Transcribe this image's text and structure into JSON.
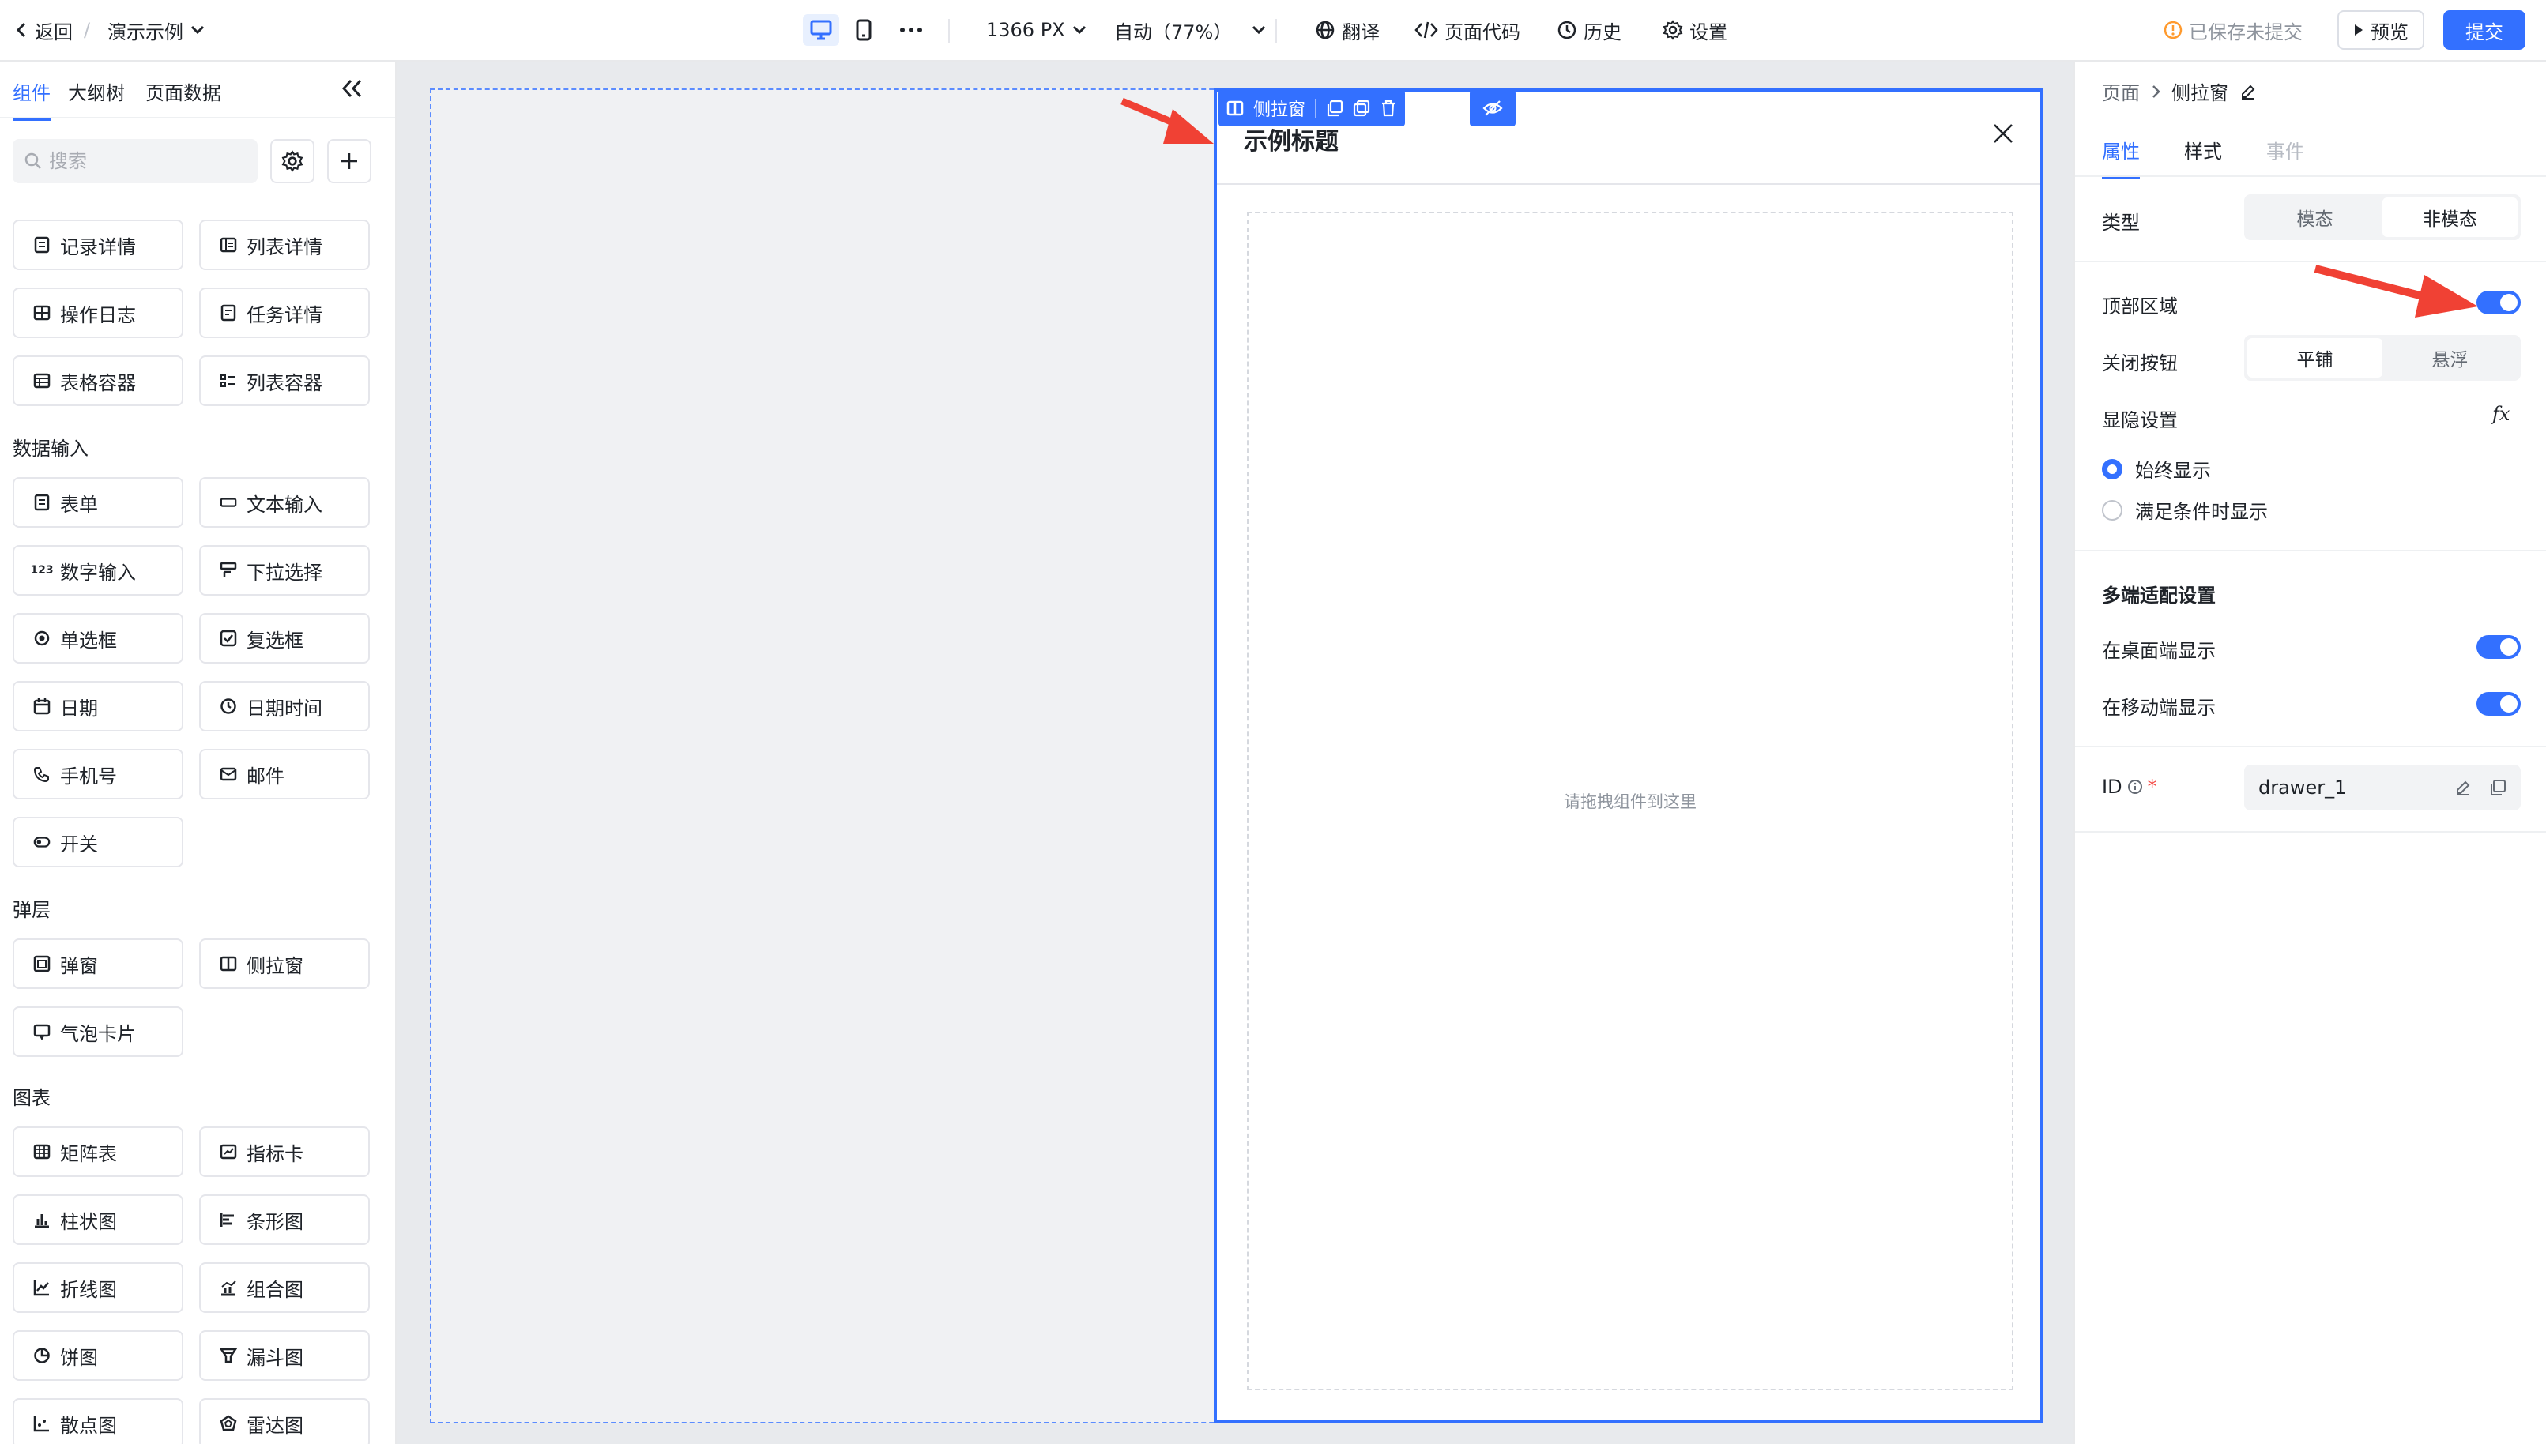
{
  "header": {
    "back_label": "返回",
    "breadcrumb_sep": "/",
    "app_name": "演示示例",
    "width_value": "1366 PX",
    "zoom_value": "自动（77%）",
    "translate_label": "翻译",
    "page_code_label": "页面代码",
    "history_label": "历史",
    "settings_label": "设置",
    "save_status": "已保存未提交",
    "preview_label": "预览",
    "submit_label": "提交"
  },
  "left_panel": {
    "tabs": [
      "组件",
      "大纲树",
      "页面数据"
    ],
    "search_placeholder": "搜索",
    "components_top": [
      "记录详情",
      "列表详情",
      "操作日志",
      "任务详情",
      "表格容器",
      "列表容器"
    ],
    "section_input": "数据输入",
    "components_input": [
      "表单",
      "文本输入",
      "数字输入",
      "下拉选择",
      "单选框",
      "复选框",
      "日期",
      "日期时间",
      "手机号",
      "邮件",
      "开关"
    ],
    "number_icon_text": "123",
    "section_layer": "弹层",
    "components_layer": [
      "弹窗",
      "侧拉窗",
      "气泡卡片"
    ],
    "section_chart": "图表",
    "components_chart": [
      "矩阵表",
      "指标卡",
      "柱状图",
      "条形图",
      "折线图",
      "组合图",
      "饼图",
      "漏斗图",
      "散点图",
      "雷达图"
    ]
  },
  "canvas": {
    "toolbar_label": "侧拉窗",
    "drawer_title": "示例标题",
    "dropzone_text": "请拖拽组件到这里"
  },
  "right_panel": {
    "breadcrumb_root": "页面",
    "breadcrumb_current": "侧拉窗",
    "tabs": [
      "属性",
      "样式",
      "事件"
    ],
    "type_label": "类型",
    "type_options": [
      "模态",
      "非模态"
    ],
    "top_area_label": "顶部区域",
    "close_button_label": "关闭按钮",
    "close_button_options": [
      "平铺",
      "悬浮"
    ],
    "visibility_label": "显隐设置",
    "fx_label": "fx",
    "visibility_options": [
      "始终显示",
      "满足条件时显示"
    ],
    "multi_device_title": "多端适配设置",
    "desktop_label": "在桌面端显示",
    "mobile_label": "在移动端显示",
    "id_label": "ID",
    "id_required": "*",
    "id_value": "drawer_1"
  },
  "colors": {
    "primary": "#3370ff",
    "warning": "#ff9a2e",
    "annotation_arrow": "#f04134"
  }
}
